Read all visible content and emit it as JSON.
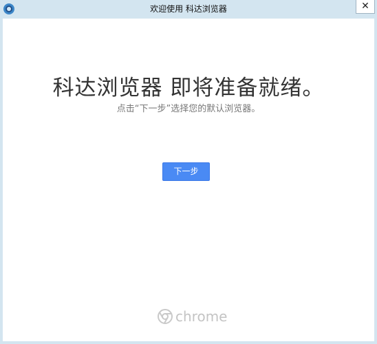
{
  "window": {
    "title": "欢迎使用 科达浏览器",
    "close_glyph": "✕",
    "icon": "app-logo-icon"
  },
  "main": {
    "headline": "科达浏览器 即将准备就绪。",
    "subline": "点击“下一步”选择您的默认浏览器。",
    "next_button_label": "下一步"
  },
  "footer": {
    "brand_text": "chrome",
    "brand_icon": "chrome-logo-icon"
  },
  "colors": {
    "titlebar": "#d3e5f0",
    "button": "#4a8af4",
    "brand_gray": "#c4c4c4"
  }
}
